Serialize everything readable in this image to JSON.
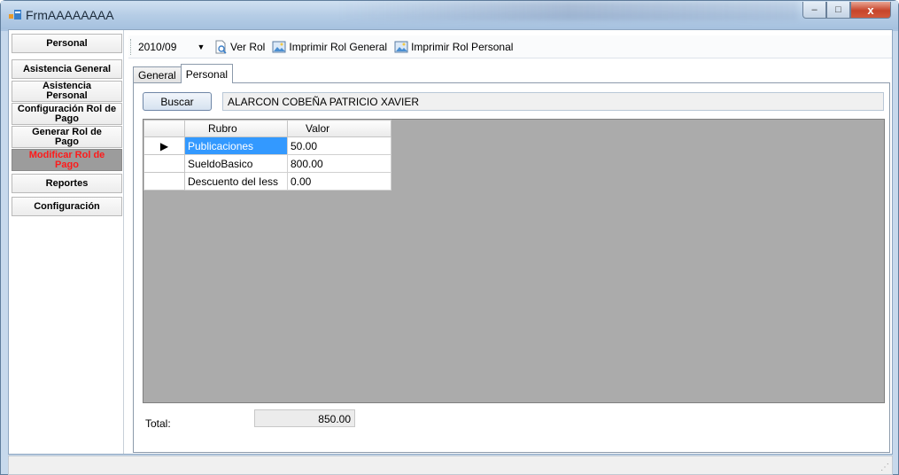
{
  "window": {
    "title": "FrmAAAAAAAA",
    "controls": {
      "minimize": "–",
      "maximize": "□",
      "close": "x"
    }
  },
  "sidebar": {
    "items": [
      {
        "label": "Personal"
      },
      {
        "label": "Asistencia General"
      },
      {
        "label": "Asistencia Personal"
      },
      {
        "label": "Configuración Rol de Pago"
      },
      {
        "label": "Generar Rol de Pago"
      },
      {
        "label": "Modificar Rol de Pago",
        "active": true
      },
      {
        "label": "Reportes"
      },
      {
        "label": "Configuración"
      }
    ]
  },
  "toolbar": {
    "period": "2010/09",
    "ver_rol": "Ver Rol",
    "imprimir_general": "Imprimir Rol General",
    "imprimir_personal": "Imprimir Rol Personal"
  },
  "tabs": [
    {
      "label": "General"
    },
    {
      "label": "Personal",
      "selected": true
    }
  ],
  "search": {
    "button": "Buscar",
    "employee_name": "ALARCON COBEÑA PATRICIO XAVIER"
  },
  "grid": {
    "columns": [
      "Rubro",
      "Valor"
    ],
    "rows": [
      {
        "rubro": "Publicaciones",
        "valor": "50.00"
      },
      {
        "rubro": "SueldoBasico",
        "valor": "800.00"
      },
      {
        "rubro": "Descuento del Iess",
        "valor": "0.00"
      }
    ]
  },
  "total": {
    "label": "Total:",
    "value": "850.00"
  },
  "colors": {
    "active_nav_text": "#ff1a1a",
    "active_nav_bg": "#9c9c9c",
    "selection": "#3399ff",
    "grid_background": "#ababab"
  }
}
